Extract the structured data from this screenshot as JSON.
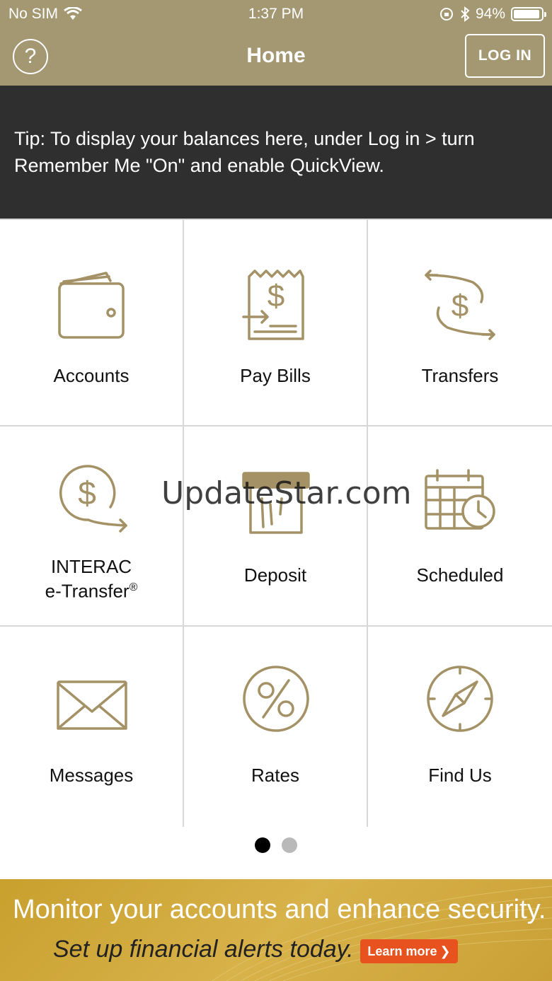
{
  "status_bar": {
    "carrier": "No SIM",
    "time": "1:37 PM",
    "battery": "94%",
    "battery_level": 0.94
  },
  "header": {
    "help_label": "?",
    "title": "Home",
    "login_label": "LOG IN"
  },
  "tip": {
    "text": "Tip: To display your balances here, under Log in > turn Remember Me \"On\" and enable QuickView."
  },
  "tiles": {
    "accounts": "Accounts",
    "pay_bills": "Pay Bills",
    "transfers": "Transfers",
    "interac_line1": "INTERAC",
    "interac_line2": "e-Transfer",
    "interac_reg": "®",
    "deposit": "Deposit",
    "scheduled": "Scheduled",
    "messages": "Messages",
    "rates": "Rates",
    "find_us": "Find Us"
  },
  "watermark": "UpdateStar.com",
  "pagination": {
    "current": 1,
    "total": 2
  },
  "promo": {
    "headline": "Monitor your accounts and enhance security.",
    "subline": "Set up financial alerts today.",
    "button_label": "Learn more",
    "button_chevron": "❯"
  },
  "colors": {
    "brand_gold": "#a49872",
    "icon_gold": "#a49266",
    "tip_bg": "#2f2f2f",
    "promo_button": "#e8521e"
  },
  "icons": {
    "accounts": "wallet-icon",
    "pay_bills": "receipt-icon",
    "transfers": "transfer-arrows-icon",
    "interac": "dollar-arrow-icon",
    "deposit": "deposit-icon",
    "scheduled": "calendar-clock-icon",
    "messages": "envelope-icon",
    "rates": "percent-icon",
    "find_us": "compass-icon"
  }
}
